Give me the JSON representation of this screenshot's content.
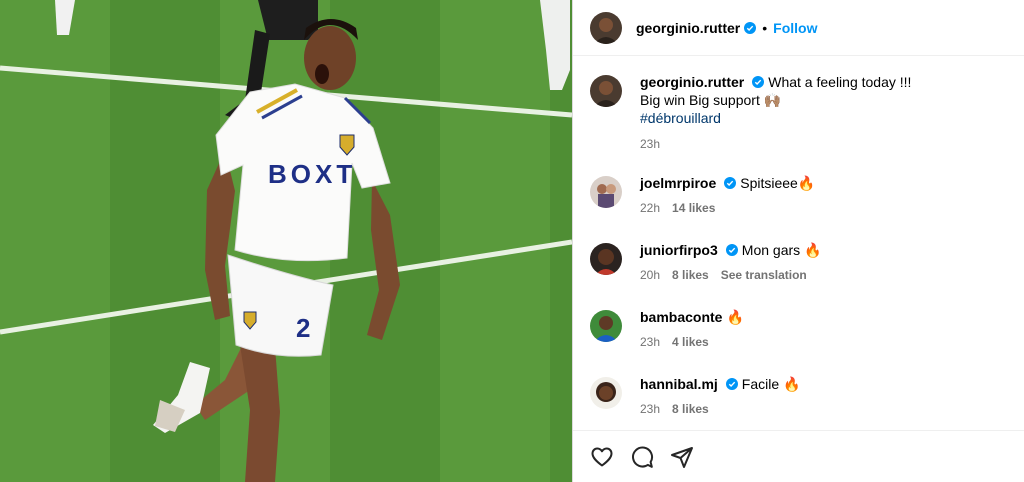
{
  "post": {
    "author": "georginio.rutter",
    "follow_label": "Follow",
    "separator": "•",
    "photo": {
      "jersey_text": "BOXT",
      "jersey_number": "2"
    }
  },
  "caption": {
    "username": "georginio.rutter",
    "text": "What a feeling today !!!",
    "line2": "Big win Big support 🙌🏽",
    "hashtag": "#débrouillard",
    "time": "23h"
  },
  "comments": [
    {
      "username": "joelmrpiroe",
      "verified": true,
      "text": "Spitsieee🔥",
      "time": "22h",
      "likes": "14 likes",
      "extra": ""
    },
    {
      "username": "juniorfirpo3",
      "verified": true,
      "text": "Mon gars 🔥",
      "time": "20h",
      "likes": "8 likes",
      "extra": "See translation"
    },
    {
      "username": "bambaconte",
      "verified": false,
      "text": "🔥",
      "time": "23h",
      "likes": "4 likes",
      "extra": ""
    },
    {
      "username": "hannibal.mj",
      "verified": true,
      "text": "Facile 🔥",
      "time": "23h",
      "likes": "8 likes",
      "extra": ""
    }
  ],
  "actions": [
    "heart-icon",
    "comment-icon",
    "share-icon"
  ],
  "colors": {
    "link": "#0095f6",
    "hashtag": "#00376b",
    "verified": "#0095f6",
    "muted": "#737373"
  }
}
